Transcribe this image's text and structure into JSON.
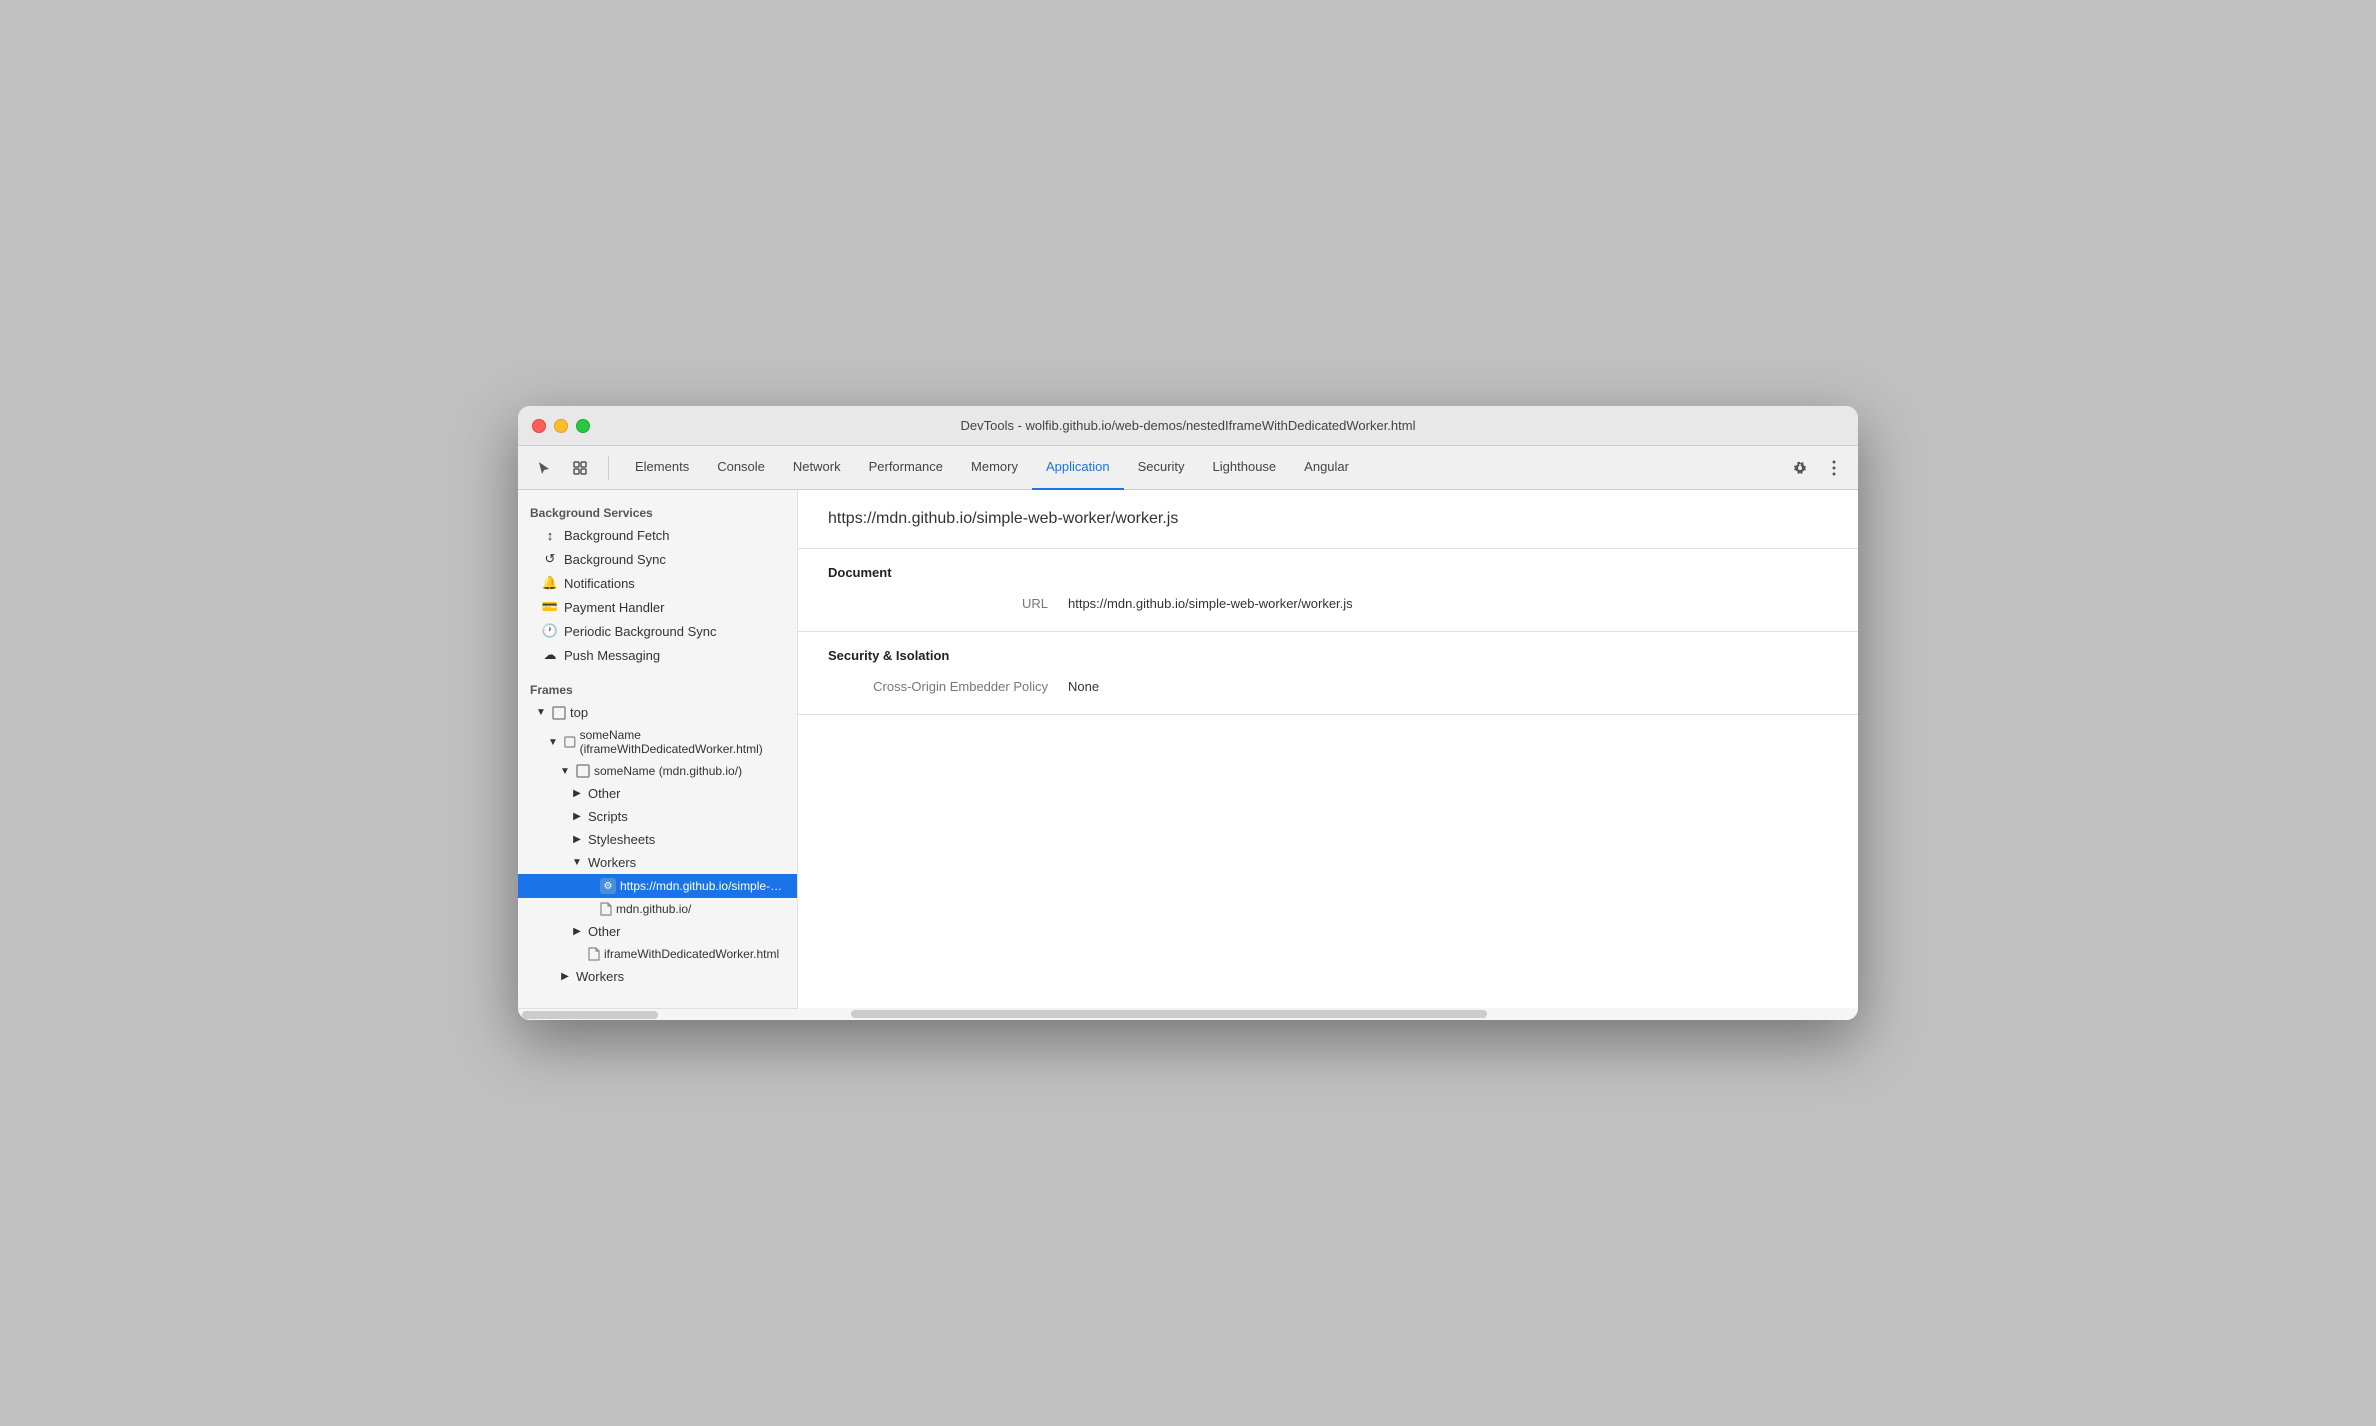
{
  "window": {
    "title": "DevTools - wolfib.github.io/web-demos/nestedIframeWithDedicatedWorker.html"
  },
  "tabs": [
    {
      "id": "elements",
      "label": "Elements",
      "active": false
    },
    {
      "id": "console",
      "label": "Console",
      "active": false
    },
    {
      "id": "network",
      "label": "Network",
      "active": false
    },
    {
      "id": "performance",
      "label": "Performance",
      "active": false
    },
    {
      "id": "memory",
      "label": "Memory",
      "active": false
    },
    {
      "id": "application",
      "label": "Application",
      "active": true
    },
    {
      "id": "security",
      "label": "Security",
      "active": false
    },
    {
      "id": "lighthouse",
      "label": "Lighthouse",
      "active": false
    },
    {
      "id": "angular",
      "label": "Angular",
      "active": false
    }
  ],
  "sidebar": {
    "background_services_title": "Background Services",
    "items": [
      {
        "id": "background-fetch",
        "label": "Background Fetch",
        "icon": "↕"
      },
      {
        "id": "background-sync",
        "label": "Background Sync",
        "icon": "↺"
      },
      {
        "id": "notifications",
        "label": "Notifications",
        "icon": "🔔"
      },
      {
        "id": "payment-handler",
        "label": "Payment Handler",
        "icon": "💳"
      },
      {
        "id": "periodic-background-sync",
        "label": "Periodic Background Sync",
        "icon": "🕐"
      },
      {
        "id": "push-messaging",
        "label": "Push Messaging",
        "icon": "☁"
      }
    ],
    "frames_title": "Frames",
    "tree": [
      {
        "id": "top",
        "label": "top",
        "indent": 0,
        "arrow": "▼",
        "icon": "frame",
        "selected": false
      },
      {
        "id": "someName-iframe",
        "label": "someName (iframeWithDedicatedWorker.html)",
        "indent": 1,
        "arrow": "▼",
        "icon": "frame",
        "selected": false
      },
      {
        "id": "someName-mdn",
        "label": "someName (mdn.github.io/)",
        "indent": 2,
        "arrow": "▼",
        "icon": "frame",
        "selected": false
      },
      {
        "id": "other-1",
        "label": "Other",
        "indent": 3,
        "arrow": "▶",
        "icon": null,
        "selected": false
      },
      {
        "id": "scripts-1",
        "label": "Scripts",
        "indent": 3,
        "arrow": "▶",
        "icon": null,
        "selected": false
      },
      {
        "id": "stylesheets-1",
        "label": "Stylesheets",
        "indent": 3,
        "arrow": "▶",
        "icon": null,
        "selected": false
      },
      {
        "id": "workers-1",
        "label": "Workers",
        "indent": 3,
        "arrow": "▼",
        "icon": null,
        "selected": false
      },
      {
        "id": "worker-url",
        "label": "https://mdn.github.io/simple-web-worker",
        "indent": 4,
        "arrow": null,
        "icon": "worker",
        "selected": true
      },
      {
        "id": "mdn-file",
        "label": "mdn.github.io/",
        "indent": 4,
        "arrow": null,
        "icon": "file",
        "selected": false
      },
      {
        "id": "other-2",
        "label": "Other",
        "indent": 3,
        "arrow": "▶",
        "icon": null,
        "selected": false
      },
      {
        "id": "iframe-file",
        "label": "iframeWithDedicatedWorker.html",
        "indent": 3,
        "arrow": null,
        "icon": "file",
        "selected": false
      },
      {
        "id": "workers-2",
        "label": "Workers",
        "indent": 2,
        "arrow": "▶",
        "icon": null,
        "selected": false
      }
    ]
  },
  "detail": {
    "url": "https://mdn.github.io/simple-web-worker/worker.js",
    "document_title": "Document",
    "url_label": "URL",
    "url_value": "https://mdn.github.io/simple-web-worker/worker.js",
    "security_isolation_title": "Security & Isolation",
    "coep_label": "Cross-Origin Embedder Policy",
    "coep_value": "None"
  }
}
